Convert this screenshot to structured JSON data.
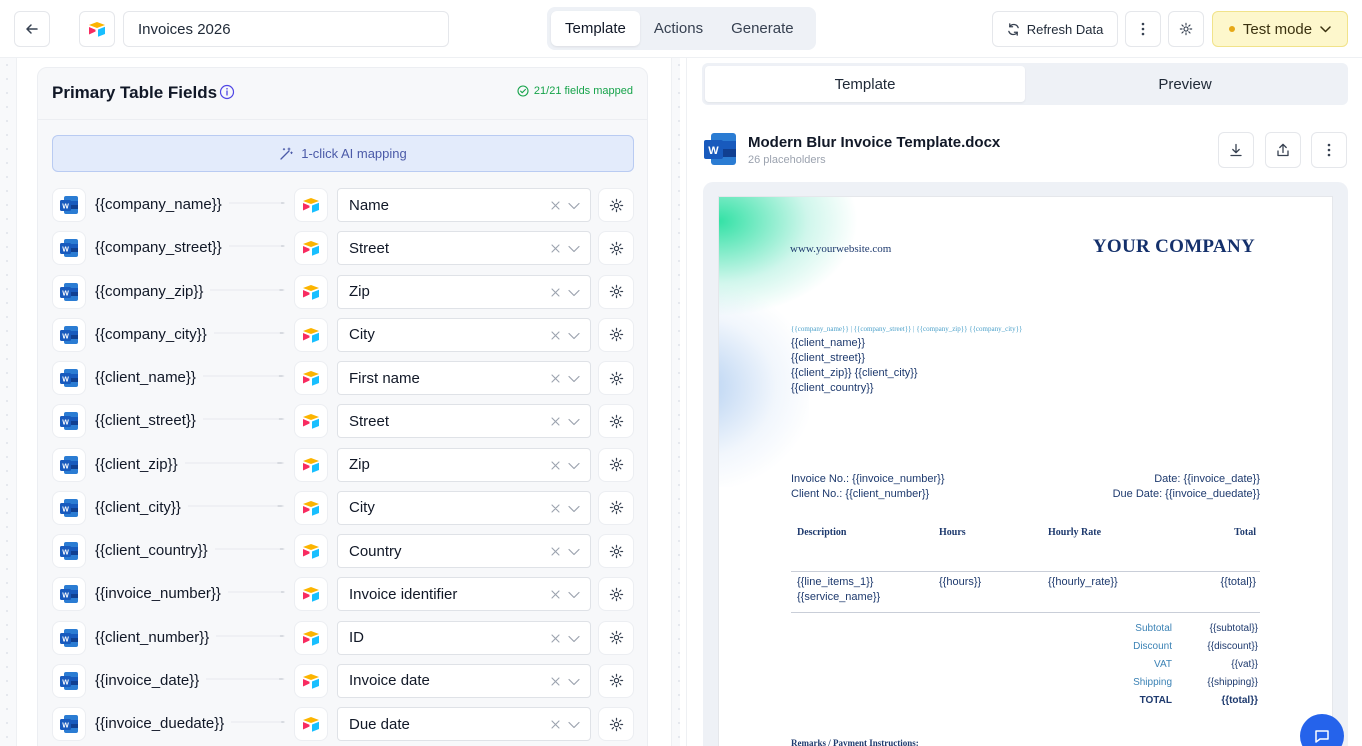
{
  "header": {
    "title_value": "Invoices 2026",
    "tabs": [
      {
        "label": "Template",
        "active": true
      },
      {
        "label": "Actions",
        "active": false
      },
      {
        "label": "Generate",
        "active": false
      }
    ],
    "refresh_label": "Refresh Data",
    "test_mode_label": "Test mode"
  },
  "panel": {
    "title": "Primary Table Fields",
    "mapped_label": "21/21 fields mapped",
    "ai_button_label": "1-click AI mapping"
  },
  "mappings": [
    {
      "placeholder": "{{company_name}}",
      "field": "Name"
    },
    {
      "placeholder": "{{company_street}}",
      "field": "Street"
    },
    {
      "placeholder": "{{company_zip}}",
      "field": "Zip"
    },
    {
      "placeholder": "{{company_city}}",
      "field": "City"
    },
    {
      "placeholder": "{{client_name}}",
      "field": "First name"
    },
    {
      "placeholder": "{{client_street}}",
      "field": "Street"
    },
    {
      "placeholder": "{{client_zip}}",
      "field": "Zip"
    },
    {
      "placeholder": "{{client_city}}",
      "field": "City"
    },
    {
      "placeholder": "{{client_country}}",
      "field": "Country"
    },
    {
      "placeholder": "{{invoice_number}}",
      "field": "Invoice identifier"
    },
    {
      "placeholder": "{{client_number}}",
      "field": "ID"
    },
    {
      "placeholder": "{{invoice_date}}",
      "field": "Invoice date"
    },
    {
      "placeholder": "{{invoice_duedate}}",
      "field": "Due date"
    }
  ],
  "preview": {
    "tabs": [
      {
        "label": "Template",
        "active": true
      },
      {
        "label": "Preview",
        "active": false
      }
    ],
    "file_name": "Modern Blur Invoice Template.docx",
    "file_sub": "26 placeholders"
  },
  "document": {
    "website": "www.yourwebsite.com",
    "company": "YOUR COMPANY",
    "sender_line": "{{company_name}} | {{company_street}} | {{company_zip}} {{company_city}}",
    "client_lines": [
      "{{client_name}}",
      "{{client_street}}",
      "{{client_zip}} {{client_city}}",
      "{{client_country}}"
    ],
    "invoice_no": "Invoice No.: {{invoice_number}}",
    "client_no": "Client No.: {{client_number}}",
    "date": "Date: {{invoice_date}}",
    "due_date": "Due Date: {{invoice_duedate}}",
    "table_headers": [
      "Description",
      "Hours",
      "Hourly Rate",
      "Total"
    ],
    "row": {
      "description_1": "{{line_items_1}}",
      "description_2": "{{service_name}}",
      "hours": "{{hours}}",
      "rate": "{{hourly_rate}}",
      "total": "{{total}}"
    },
    "summary": [
      {
        "label": "Subtotal",
        "value": "{{subtotal}}"
      },
      {
        "label": "Discount",
        "value": "{{discount}}"
      },
      {
        "label": "VAT",
        "value": "{{vat}}"
      },
      {
        "label": "Shipping",
        "value": "{{shipping}}"
      },
      {
        "label": "TOTAL",
        "value": "{{total}}"
      }
    ],
    "remarks": "Remarks / Payment Instructions:"
  },
  "colors": {
    "accent_green": "#16a34a",
    "test_mode_bg": "#fdf7cc",
    "word_blue": "#185abd",
    "doc_navy": "#14306b"
  }
}
